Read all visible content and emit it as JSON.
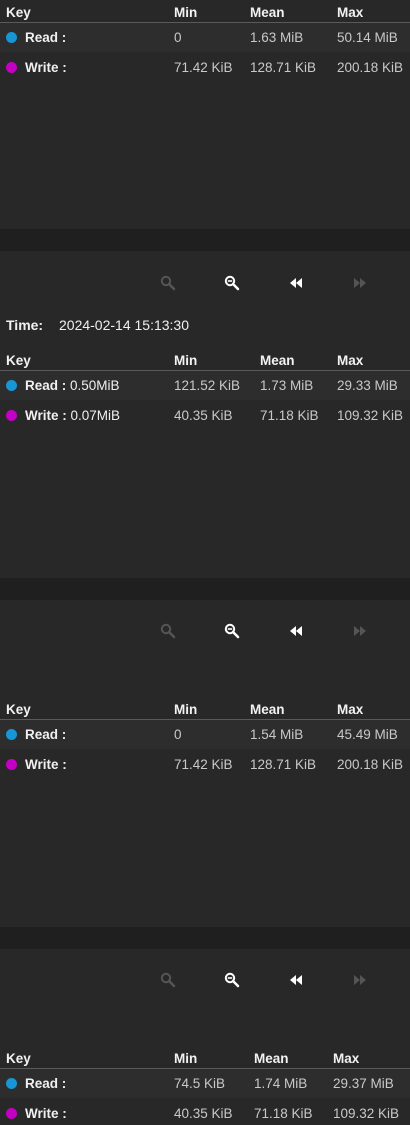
{
  "colors": {
    "read": "#1796d6",
    "write": "#c300c3",
    "icon_enabled": "#ffffff",
    "icon_disabled": "#555555"
  },
  "icons": [
    "zoom-in-icon",
    "zoom-out-icon",
    "rewind-icon",
    "fast-forward-icon"
  ],
  "headers": {
    "key": "Key",
    "min": "Min",
    "mean": "Mean",
    "max": "Max"
  },
  "panels": [
    {
      "rows": [
        {
          "key": "Read :",
          "value": "",
          "min": "0",
          "mean": "1.63 MiB",
          "max": "50.14 MiB"
        },
        {
          "key": "Write :",
          "value": "",
          "min": "71.42 KiB",
          "mean": "128.71 KiB",
          "max": "200.18 KiB"
        }
      ]
    },
    {
      "time_label": "Time:",
      "time_value": "2024-02-14 15:13:30",
      "rows": [
        {
          "key": "Read :",
          "value": "0.50MiB",
          "min": "121.52 KiB",
          "mean": "1.73 MiB",
          "max": "29.33 MiB"
        },
        {
          "key": "Write :",
          "value": "0.07MiB",
          "min": "40.35 KiB",
          "mean": "71.18 KiB",
          "max": "109.32 KiB"
        }
      ]
    },
    {
      "rows": [
        {
          "key": "Read :",
          "value": "",
          "min": "0",
          "mean": "1.54 MiB",
          "max": "45.49 MiB"
        },
        {
          "key": "Write :",
          "value": "",
          "min": "71.42 KiB",
          "mean": "128.71 KiB",
          "max": "200.18 KiB"
        }
      ]
    },
    {
      "rows": [
        {
          "key": "Read :",
          "value": "",
          "min": "74.5 KiB",
          "mean": "1.74 MiB",
          "max": "29.37 MiB"
        },
        {
          "key": "Write :",
          "value": "",
          "min": "40.35 KiB",
          "mean": "71.18 KiB",
          "max": "109.32 KiB"
        }
      ]
    }
  ]
}
